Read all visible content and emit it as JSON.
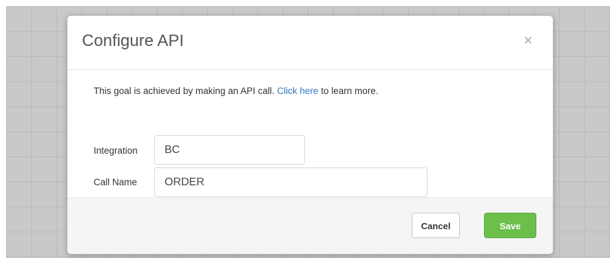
{
  "dialog": {
    "title": "Configure API",
    "close_glyph": "×",
    "intro_text": "This goal is achieved by making an API call.",
    "intro_link": "Click here",
    "intro_suffix": "to learn more."
  },
  "fields": {
    "integration": {
      "label": "Integration",
      "value": "BC"
    },
    "call_name": {
      "label": "Call Name",
      "value": "ORDER"
    }
  },
  "footer": {
    "cancel_label": "Cancel",
    "save_label": "Save"
  },
  "colors": {
    "save_button": "#6cbf4a",
    "link": "#2f7bbf",
    "background_grid": "#c9c9c9"
  }
}
